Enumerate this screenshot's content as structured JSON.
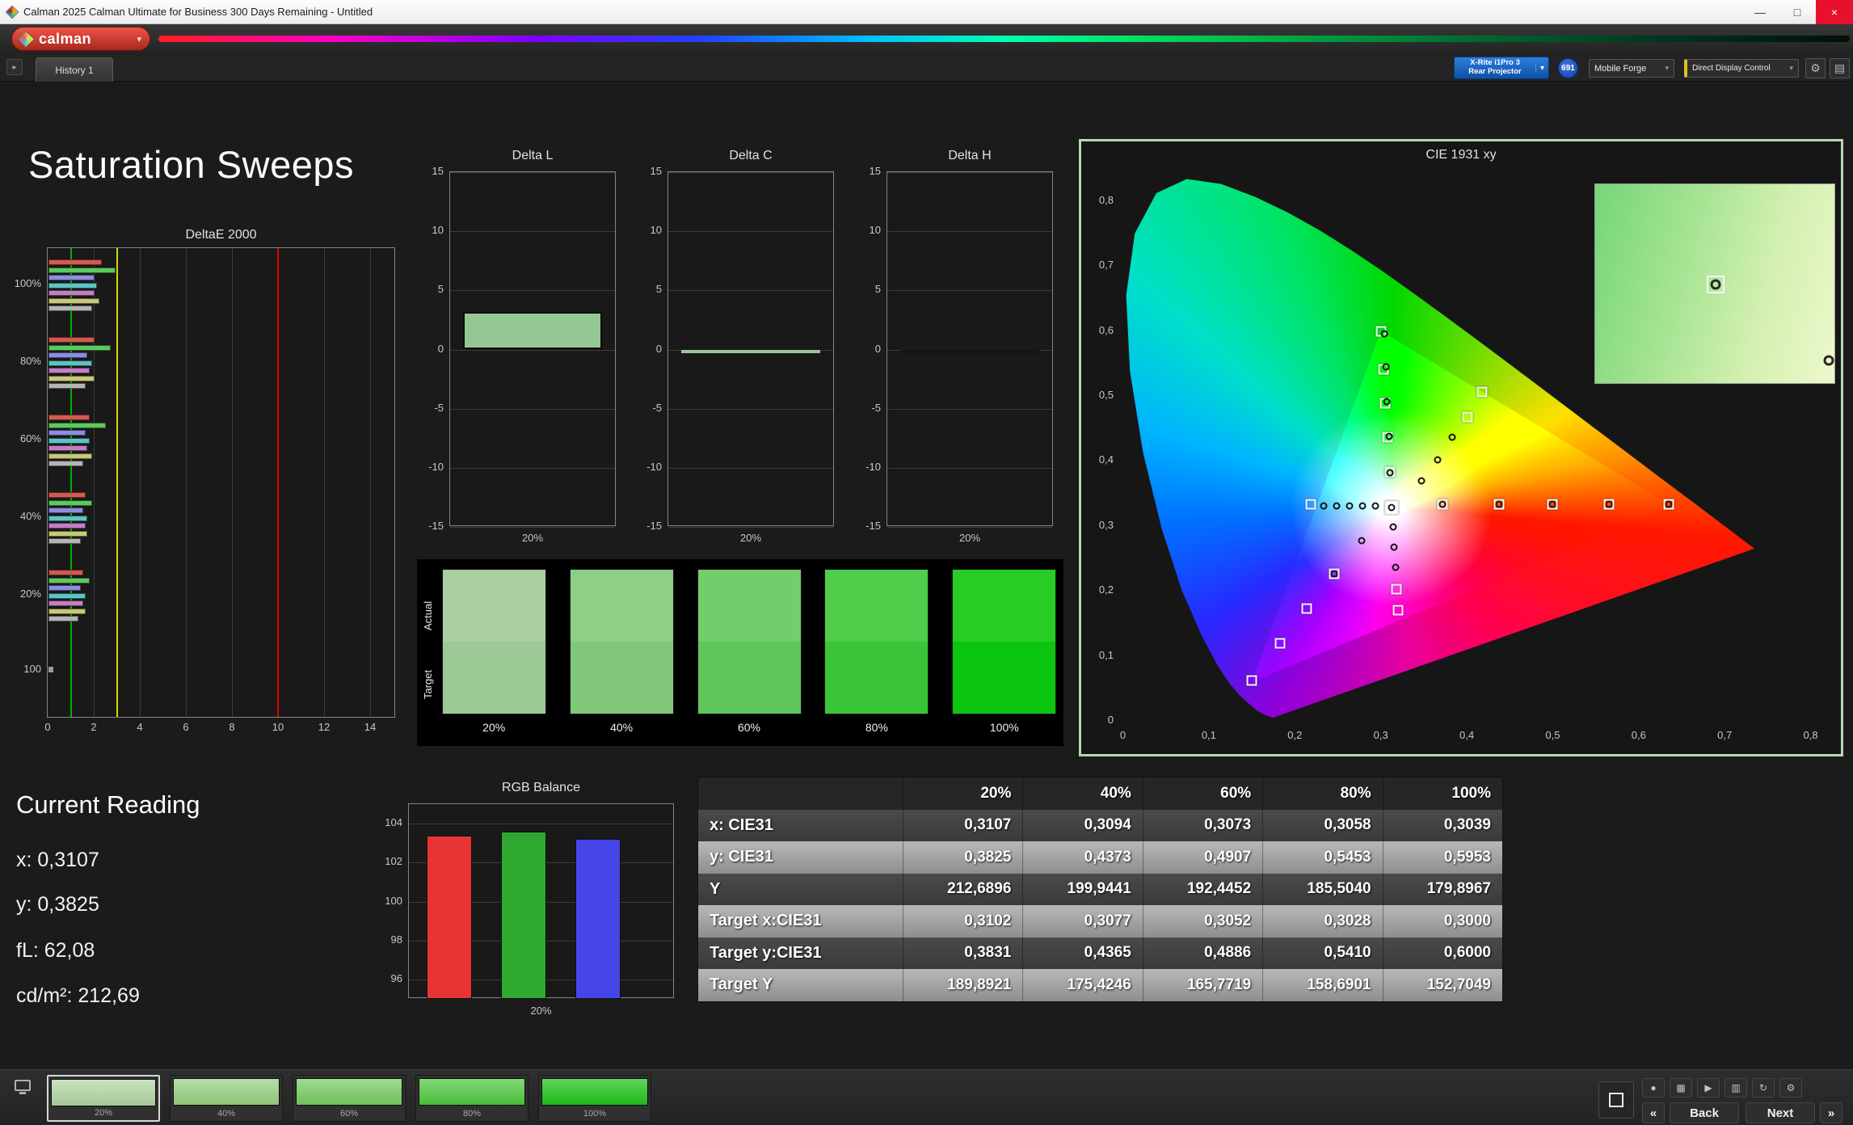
{
  "window": {
    "title": "Calman 2025 Calman Ultimate for Business 300 Days Remaining - Untitled",
    "controls": {
      "minimize": "—",
      "maximize": "□",
      "close": "×"
    }
  },
  "brand": {
    "name": "calman",
    "arrow": "▾"
  },
  "toolbar": {
    "history_prev": "▸",
    "history_tab": "History 1",
    "meter": {
      "line1": "X-Rite i1Pro 3",
      "line2": "Rear Projector"
    },
    "badge": "691",
    "pattern_source": "Mobile Forge",
    "display_control": "Direct Display Control",
    "arrow": "▾",
    "gear": "⚙"
  },
  "page_title": "Saturation Sweeps",
  "current_reading": {
    "title": "Current Reading",
    "lines": [
      "x: 0,3107",
      "y: 0,3825",
      "fL: 62,08",
      "cd/m²: 212,69"
    ]
  },
  "chart_data": [
    {
      "id": "deltae2000",
      "type": "bar",
      "orientation": "horizontal",
      "title": "DeltaE 2000",
      "xlim": [
        0,
        15.1
      ],
      "xticks": [
        0,
        2,
        4,
        6,
        8,
        10,
        12,
        14
      ],
      "group_labels": [
        "100%",
        "80%",
        "60%",
        "40%",
        "20%",
        "100"
      ],
      "reference_lines": [
        {
          "x": 1,
          "color": "#00b000"
        },
        {
          "x": 3,
          "color": "#d6d600"
        },
        {
          "x": 10,
          "color": "#dd0000"
        }
      ],
      "groups": [
        {
          "label": "100%",
          "bars": [
            {
              "color": "#d25a50",
              "value": 2.3
            },
            {
              "color": "#5dc85d",
              "value": 2.9
            },
            {
              "color": "#8c8ce0",
              "value": 2.0
            },
            {
              "color": "#5cc4c4",
              "value": 2.1
            },
            {
              "color": "#c47ec4",
              "value": 2.0
            },
            {
              "color": "#c8c87a",
              "value": 2.2
            },
            {
              "color": "#b4b4b4",
              "value": 1.9
            }
          ]
        },
        {
          "label": "80%",
          "bars": [
            {
              "color": "#d25a50",
              "value": 2.0
            },
            {
              "color": "#5dc85d",
              "value": 2.7
            },
            {
              "color": "#8c8ce0",
              "value": 1.7
            },
            {
              "color": "#5cc4c4",
              "value": 1.9
            },
            {
              "color": "#c47ec4",
              "value": 1.8
            },
            {
              "color": "#c8c87a",
              "value": 2.0
            },
            {
              "color": "#b4b4b4",
              "value": 1.6
            }
          ]
        },
        {
          "label": "60%",
          "bars": [
            {
              "color": "#d25a50",
              "value": 1.8
            },
            {
              "color": "#5dc85d",
              "value": 2.5
            },
            {
              "color": "#8c8ce0",
              "value": 1.6
            },
            {
              "color": "#5cc4c4",
              "value": 1.8
            },
            {
              "color": "#c47ec4",
              "value": 1.7
            },
            {
              "color": "#c8c87a",
              "value": 1.9
            },
            {
              "color": "#b4b4b4",
              "value": 1.5
            }
          ]
        },
        {
          "label": "40%",
          "bars": [
            {
              "color": "#d25a50",
              "value": 1.6
            },
            {
              "color": "#5dc85d",
              "value": 1.9
            },
            {
              "color": "#8c8ce0",
              "value": 1.5
            },
            {
              "color": "#5cc4c4",
              "value": 1.7
            },
            {
              "color": "#c47ec4",
              "value": 1.6
            },
            {
              "color": "#c8c87a",
              "value": 1.7
            },
            {
              "color": "#b4b4b4",
              "value": 1.4
            }
          ]
        },
        {
          "label": "20%",
          "bars": [
            {
              "color": "#d25a50",
              "value": 1.5
            },
            {
              "color": "#5dc85d",
              "value": 1.8
            },
            {
              "color": "#8c8ce0",
              "value": 1.4
            },
            {
              "color": "#5cc4c4",
              "value": 1.6
            },
            {
              "color": "#c47ec4",
              "value": 1.5
            },
            {
              "color": "#c8c87a",
              "value": 1.6
            },
            {
              "color": "#b4b4b4",
              "value": 1.3
            }
          ]
        }
      ],
      "tail": {
        "label": "100",
        "bar": {
          "color": "#9a9a9a",
          "value": 0.2
        }
      }
    },
    {
      "id": "delta_l",
      "type": "bar",
      "title": "Delta L",
      "ylim": [
        -15,
        15
      ],
      "yticks": [
        15,
        10,
        5,
        0,
        -5,
        -10,
        -15
      ],
      "categories": [
        "20%"
      ],
      "values": [
        3.2
      ],
      "bar_color": "#95c795"
    },
    {
      "id": "delta_c",
      "type": "bar",
      "title": "Delta C",
      "ylim": [
        -15,
        15
      ],
      "yticks": [
        15,
        10,
        5,
        0,
        -5,
        -10,
        -15
      ],
      "categories": [
        "20%"
      ],
      "values": [
        -0.3
      ],
      "bar_color": "#95c795"
    },
    {
      "id": "delta_h",
      "type": "bar",
      "title": "Delta H",
      "ylim": [
        -15,
        15
      ],
      "yticks": [
        15,
        10,
        5,
        0,
        -5,
        -10,
        -15
      ],
      "categories": [
        "20%"
      ],
      "values": [
        -0.1
      ],
      "bar_color": "#141414"
    },
    {
      "id": "rgb_balance",
      "type": "bar",
      "title": "RGB Balance",
      "ylim": [
        95,
        105
      ],
      "yticks": [
        104,
        102,
        100,
        98,
        96
      ],
      "categories": [
        "20%"
      ],
      "series": [
        {
          "name": "Red",
          "color": "#e83434",
          "value": 103.4
        },
        {
          "name": "Green",
          "color": "#2fa82f",
          "value": 103.6
        },
        {
          "name": "Blue",
          "color": "#4646e8",
          "value": 103.2
        }
      ]
    },
    {
      "id": "cie1931",
      "type": "scatter",
      "title": "CIE 1931 xy",
      "xlim": [
        0,
        0.8
      ],
      "ylim": [
        0,
        0.8
      ],
      "xticks": [
        "0",
        "0,1",
        "0,2",
        "0,3",
        "0,4",
        "0,5",
        "0,6",
        "0,7",
        "0,8"
      ],
      "yticks": [
        "0",
        "0,1",
        "0,2",
        "0,3",
        "0,4",
        "0,5",
        "0,6",
        "0,7",
        "0,8"
      ],
      "gamut_triangle": [
        [
          0.64,
          0.33
        ],
        [
          0.3,
          0.6
        ],
        [
          0.15,
          0.06
        ]
      ],
      "white_point": [
        0.3127,
        0.329
      ],
      "targets": [
        [
          0.372,
          0.333
        ],
        [
          0.438,
          0.333
        ],
        [
          0.5,
          0.333
        ],
        [
          0.565,
          0.333
        ],
        [
          0.635,
          0.333
        ],
        [
          0.3102,
          0.3831
        ],
        [
          0.3077,
          0.4365
        ],
        [
          0.3052,
          0.4886
        ],
        [
          0.3028,
          0.541
        ],
        [
          0.3,
          0.6
        ],
        [
          0.401,
          0.468
        ],
        [
          0.418,
          0.506
        ],
        [
          0.318,
          0.203
        ],
        [
          0.32,
          0.171
        ],
        [
          0.246,
          0.226
        ],
        [
          0.214,
          0.173
        ],
        [
          0.183,
          0.119
        ],
        [
          0.15,
          0.063
        ],
        [
          0.219,
          0.333
        ]
      ],
      "measurements": [
        [
          0.3107,
          0.3825
        ],
        [
          0.3094,
          0.4373
        ],
        [
          0.3073,
          0.4907
        ],
        [
          0.3058,
          0.5453
        ],
        [
          0.3039,
          0.5953
        ],
        [
          0.294,
          0.331
        ],
        [
          0.279,
          0.331
        ],
        [
          0.264,
          0.331
        ],
        [
          0.249,
          0.331
        ],
        [
          0.234,
          0.331
        ],
        [
          0.347,
          0.369
        ],
        [
          0.366,
          0.402
        ],
        [
          0.383,
          0.437
        ],
        [
          0.314,
          0.299
        ],
        [
          0.3155,
          0.268
        ],
        [
          0.317,
          0.236
        ],
        [
          0.278,
          0.278
        ],
        [
          0.246,
          0.227
        ],
        [
          0.372,
          0.334
        ],
        [
          0.438,
          0.334
        ],
        [
          0.5,
          0.334
        ],
        [
          0.565,
          0.334
        ],
        [
          0.635,
          0.334
        ]
      ],
      "inset_points": [
        [
          0.5,
          0.5
        ],
        [
          0.97,
          0.88
        ]
      ]
    }
  ],
  "swatch_strip": {
    "row_labels": [
      "Actual",
      "Target"
    ],
    "columns": [
      {
        "label": "20%",
        "actual": "#a9cfa2",
        "target": "#9dc996"
      },
      {
        "label": "40%",
        "actual": "#8ecf87",
        "target": "#80c77a"
      },
      {
        "label": "60%",
        "actual": "#71ce6b",
        "target": "#60c55b"
      },
      {
        "label": "80%",
        "actual": "#4fcd4b",
        "target": "#3ac538"
      },
      {
        "label": "100%",
        "actual": "#27cd25",
        "target": "#0cc50f"
      }
    ]
  },
  "table": {
    "col_headers": [
      "20%",
      "40%",
      "60%",
      "80%",
      "100%"
    ],
    "rows": [
      {
        "label": "x: CIE31",
        "values": [
          "0,3107",
          "0,3094",
          "0,3073",
          "0,3058",
          "0,3039"
        ]
      },
      {
        "label": "y: CIE31",
        "values": [
          "0,3825",
          "0,4373",
          "0,4907",
          "0,5453",
          "0,5953"
        ]
      },
      {
        "label": "Y",
        "values": [
          "212,6896",
          "199,9441",
          "192,4452",
          "185,5040",
          "179,8967"
        ]
      },
      {
        "label": "Target x:CIE31",
        "values": [
          "0,3102",
          "0,3077",
          "0,3052",
          "0,3028",
          "0,3000"
        ]
      },
      {
        "label": "Target y:CIE31",
        "values": [
          "0,3831",
          "0,4365",
          "0,4886",
          "0,5410",
          "0,6000"
        ]
      },
      {
        "label": "Target Y",
        "values": [
          "189,8921",
          "175,4246",
          "165,7719",
          "158,6901",
          "152,7049"
        ]
      }
    ]
  },
  "bottom_bar": {
    "swatches": [
      {
        "label": "20%",
        "color": "#b5d9a6",
        "selected": true
      },
      {
        "label": "40%",
        "color": "#99d385",
        "selected": false
      },
      {
        "label": "60%",
        "color": "#79cf63",
        "selected": false
      },
      {
        "label": "80%",
        "color": "#50cb41",
        "selected": false
      },
      {
        "label": "100%",
        "color": "#21c71c",
        "selected": false
      }
    ],
    "tools": [
      "record",
      "grid",
      "play",
      "pages",
      "refresh",
      "settings"
    ],
    "prev_icon": "«",
    "next_icon": "»",
    "back_label": "Back",
    "next_label": "Next"
  },
  "colors": {
    "panel_border_green": "#b9d7b4",
    "ref_green": "#00b000",
    "ref_yellow": "#d6d600",
    "ref_red": "#dd0000"
  }
}
